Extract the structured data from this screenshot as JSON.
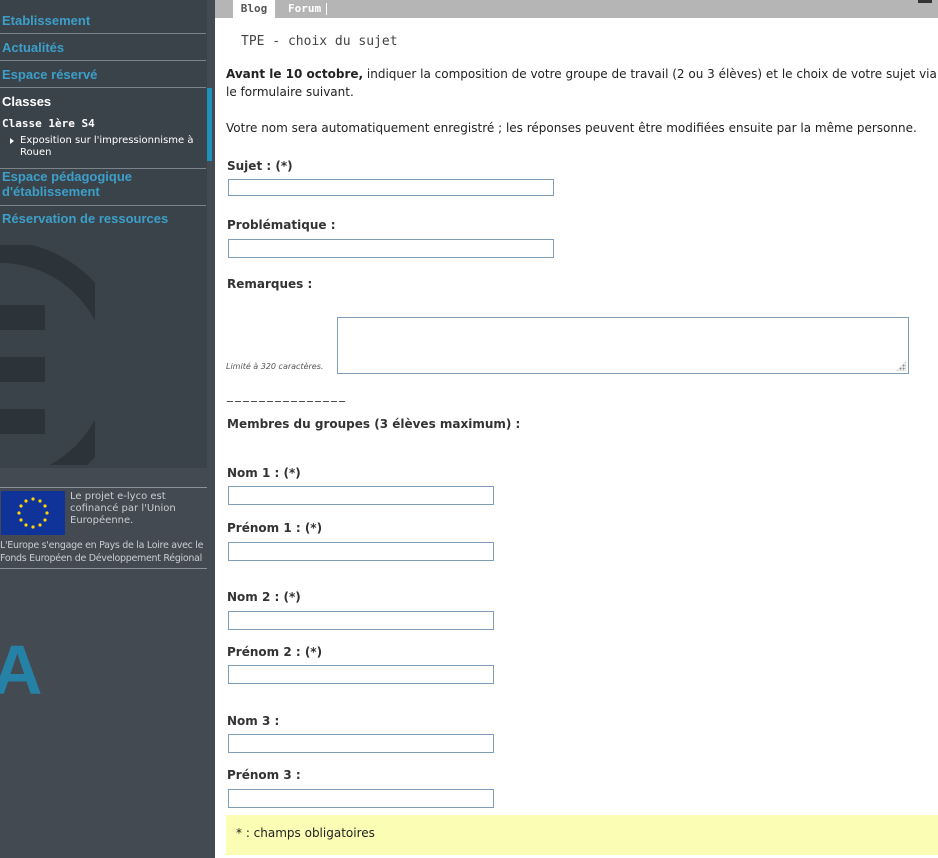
{
  "sidebar": {
    "items": [
      {
        "label": "Etablissement"
      },
      {
        "label": "Actualités"
      },
      {
        "label": "Espace réservé"
      },
      {
        "label": "Classes"
      },
      {
        "label": "Espace pédagogique d'établissement"
      },
      {
        "label": "Réservation de ressources"
      }
    ],
    "classe_title": "Classe 1ère S4",
    "classe_link": "Exposition sur l'impressionnisme à Rouen",
    "eu_text": "Le projet e-lyco est cofinancé par l'Union Européenne.",
    "eu_caption": "L'Europe s'engage en Pays de la Loire avec le Fonds Européen de Développement Régional"
  },
  "tabs": [
    {
      "label": "Blog",
      "active": true
    },
    {
      "label": "Forum",
      "active": false
    }
  ],
  "main": {
    "title": "TPE - choix du sujet",
    "intro_bold": "Avant le 10 octobre,",
    "intro_rest": " indiquer la composition de votre groupe de travail (2 ou 3 élèves) et le choix de votre sujet via le formulaire suivant.",
    "note": "Votre nom sera automatiquement enregistré ; les réponses peuvent être modifiées ensuite par la même personne.",
    "fields": {
      "sujet": "Sujet : (*)",
      "problematique": "Problématique :",
      "remarques": "Remarques :",
      "limit": "Limité à 320 caractères.",
      "dashes": "_______________",
      "membres": "Membres du groupes (3 élèves maximum) :",
      "nom1": "Nom 1 : (*)",
      "prenom1": "Prénom 1 : (*)",
      "nom2": "Nom 2 : (*)",
      "prenom2": "Prénom 2 : (*)",
      "nom3": "Nom 3 :",
      "prenom3": "Prénom 3 :"
    },
    "required_note": "* : champs obligatoires"
  },
  "colors": {
    "sidebar_bg": "#434a51",
    "link_blue": "#3c9fc9",
    "accent": "#1f8fbd",
    "required_bg": "#fbfdb4"
  }
}
